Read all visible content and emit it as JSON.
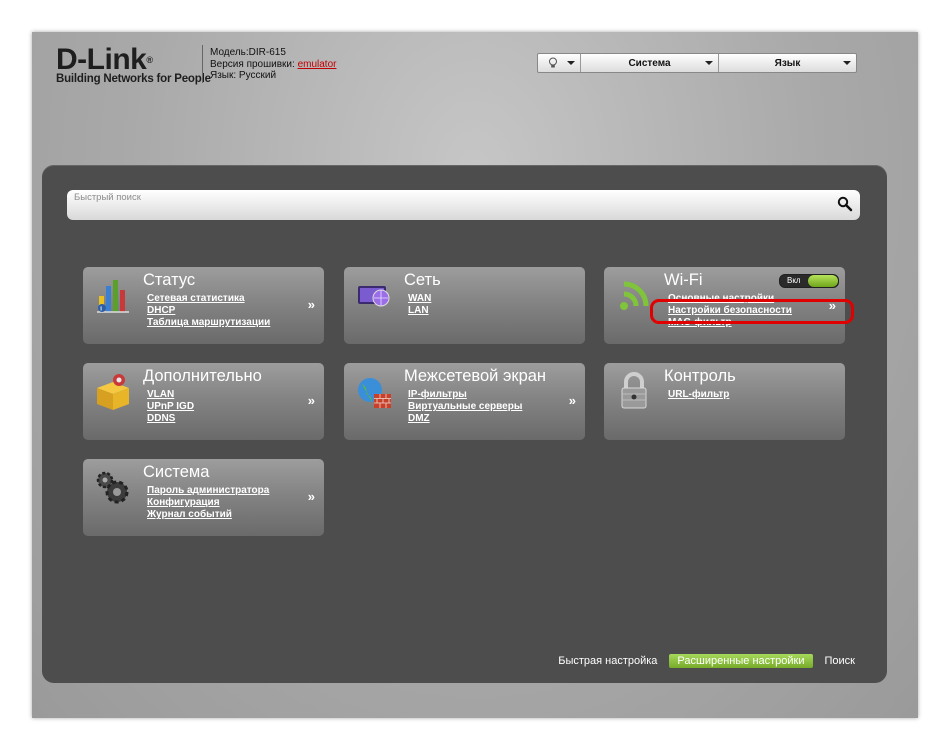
{
  "header": {
    "logo_text": "D-Link",
    "logo_reg": "®",
    "tagline": "Building Networks for People",
    "model": "Модель:DIR-615",
    "firmware_prefix": "Версия прошивки:",
    "firmware_value": "emulator",
    "language": "Язык: Русский"
  },
  "topbar": {
    "hint_icon": "lightbulb-icon",
    "system_label": "Система",
    "language_label": "Язык"
  },
  "search": {
    "placeholder": "Быстрый поиск",
    "icon": "magnifier-icon"
  },
  "tiles": {
    "status": {
      "title": "Статус",
      "icon": "bar-chart-icon",
      "links": [
        "Сетевая статистика",
        "DHCP",
        "Таблица маршрутизации"
      ],
      "arrow": "»"
    },
    "network": {
      "title": "Сеть",
      "icon": "network-globe-icon",
      "links": [
        "WAN",
        "LAN"
      ]
    },
    "wifi": {
      "title": "Wi-Fi",
      "icon": "wifi-signal-icon",
      "toggle_label": "Вкл",
      "toggle_on": true,
      "links": [
        "Основные настройки",
        "Настройки безопасности",
        "MAC-фильтр"
      ],
      "arrow": "»"
    },
    "advanced": {
      "title": "Дополнительно",
      "icon": "box-icon",
      "links": [
        "VLAN",
        "UPnP IGD",
        "DDNS"
      ],
      "arrow": "»"
    },
    "firewall": {
      "title": "Межсетевой экран",
      "icon": "firewall-icon",
      "links": [
        "IP-фильтры",
        "Виртуальные серверы",
        "DMZ"
      ],
      "arrow": "»"
    },
    "control": {
      "title": "Контроль",
      "icon": "padlock-icon",
      "links": [
        "URL-фильтр"
      ]
    },
    "system": {
      "title": "Система",
      "icon": "gears-icon",
      "links": [
        "Пароль администратора",
        "Конфигурация",
        "Журнал событий"
      ],
      "arrow": "»"
    }
  },
  "bottom_nav": {
    "quick_setup": "Быстрая настройка",
    "advanced_settings": "Расширенные настройки",
    "search": "Поиск"
  },
  "colors": {
    "accent_green": "#8dc63f",
    "highlight_red": "#e00000",
    "panel_bg": "#4d4d4d"
  }
}
